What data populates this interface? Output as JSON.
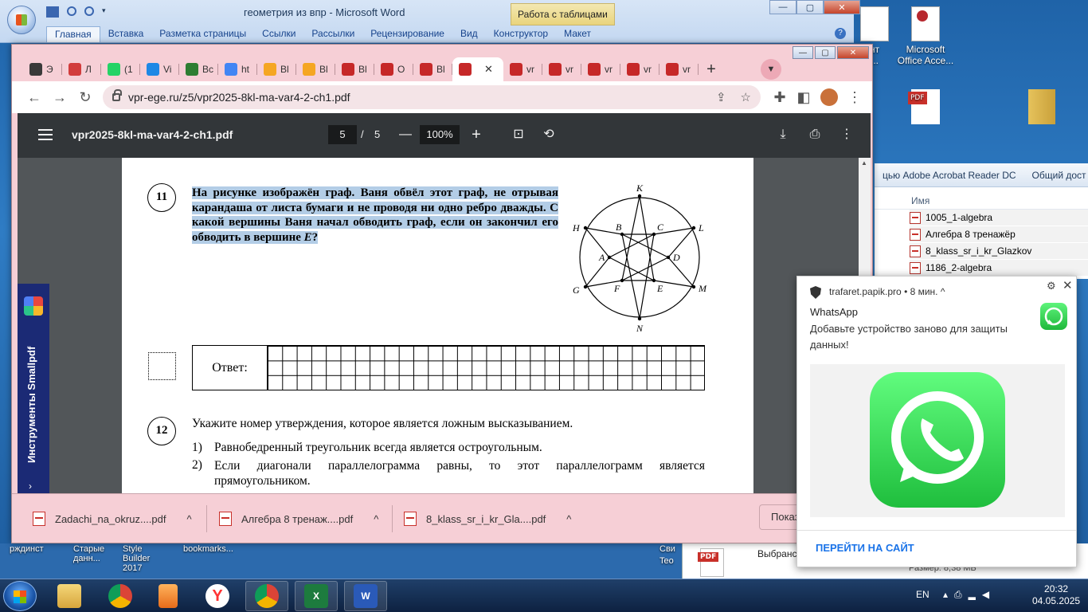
{
  "word": {
    "title": "геометрия из впр - Microsoft Word",
    "context_tab": "Работа с таблицами",
    "ribbon_tabs": [
      "Главная",
      "Вставка",
      "Разметка страницы",
      "Ссылки",
      "Рассылки",
      "Рецензирование",
      "Вид",
      "Конструктор",
      "Макет"
    ]
  },
  "desktop": {
    "icons": [
      {
        "label": "Microsoft Office Acce..."
      }
    ],
    "partial_labels": [
      "нт",
      "..."
    ],
    "bottom_labels": [
      "рждинст",
      "Старые данн...",
      "Style Builder 2017",
      "bookmarks...",
      "Сви",
      "Teo"
    ]
  },
  "explorer": {
    "toolbar": [
      "цью Adobe Acrobat Reader DC",
      "Общий дост"
    ],
    "column": "Имя",
    "files": [
      "1005_1-algebra",
      "Алгебра 8 тренажёр",
      "8_klass_sr_i_kr_Glazkov",
      "1186_2-algebra"
    ],
    "lower_file": "Выбранс",
    "lower_size": "Размер: 8,38 МБ"
  },
  "chrome": {
    "tabs": [
      {
        "text": "Э",
        "icon": "paw-icon",
        "color": "#3a3a3a"
      },
      {
        "text": "Л",
        "icon": "gift-icon",
        "color": "#d23c3c"
      },
      {
        "text": "(1",
        "icon": "whatsapp-icon",
        "color": "#25d366"
      },
      {
        "text": "Vi",
        "icon": "shield-icon",
        "color": "#1e88e5"
      },
      {
        "text": "Bc",
        "icon": "squares-icon",
        "color": "#2e7d32"
      },
      {
        "text": "ht",
        "icon": "google-icon",
        "color": "#4285f4"
      },
      {
        "text": "Bl",
        "icon": "sun-icon",
        "color": "#f5a623"
      },
      {
        "text": "Bl",
        "icon": "sun-icon",
        "color": "#f5a623"
      },
      {
        "text": "Bl",
        "icon": "chart-icon",
        "color": "#c62828"
      },
      {
        "text": "O",
        "icon": "chart-icon",
        "color": "#c62828"
      },
      {
        "text": "Bl",
        "icon": "chart-icon",
        "color": "#c62828"
      },
      {
        "text": "",
        "icon": "chart-icon",
        "color": "#c62828",
        "active": true
      },
      {
        "text": "vr",
        "icon": "chart-icon",
        "color": "#c62828"
      },
      {
        "text": "vr",
        "icon": "chart-icon",
        "color": "#c62828"
      },
      {
        "text": "vr",
        "icon": "chart-icon",
        "color": "#c62828"
      },
      {
        "text": "vr",
        "icon": "chart-icon",
        "color": "#c62828"
      },
      {
        "text": "vr",
        "icon": "chart-icon",
        "color": "#c62828"
      }
    ],
    "new_tab": "+",
    "url": "vpr-ege.ru/z5/vpr2025-8kl-ma-var4-2-ch1.pdf"
  },
  "pdf": {
    "filename": "vpr2025-8kl-ma-var4-2-ch1.pdf",
    "page": "5",
    "separator": "/",
    "total": "5",
    "zoom": "100%"
  },
  "document": {
    "q11_number": "11",
    "q11_text": "На рисунке изображён граф. Ваня обвёл этот граф, не отрывая карандаша от листа бумаги и не проводя ни одно ребро дважды. С какой вершины Ваня начал обводить граф, если он закончил его обводить в вершине ",
    "q11_vertex": "E",
    "q11_end": "?",
    "graph_vertices": [
      "K",
      "H",
      "B",
      "C",
      "L",
      "A",
      "D",
      "G",
      "F",
      "E",
      "M",
      "N"
    ],
    "answer_label": "Ответ:",
    "q12_number": "12",
    "q12_text": "Укажите номер утверждения, которое является ложным высказыванием.",
    "q12_options": [
      {
        "n": "1)",
        "text": "Равнобедренный треугольник всегда является остроугольным."
      },
      {
        "n": "2)",
        "text": "Если диагонали параллелограмма равны, то этот параллелограмм является прямоугольником."
      }
    ]
  },
  "smallpdf": {
    "label": "Инструменты Smallpdf"
  },
  "downloads": {
    "items": [
      "Zadachi_na_okruz....pdf",
      "Алгебра 8 тренаж....pdf",
      "8_klass_sr_i_kr_Gla....pdf"
    ],
    "show_all": "Показ"
  },
  "notification": {
    "source": "trafaret.papik.pro",
    "time": "• 8 мин. ^",
    "title": "WhatsApp",
    "body": "Добавьте устройство заново для защиты данных!",
    "action": "ПЕРЕЙТИ НА САЙТ"
  },
  "taskbar": {
    "lang": "EN",
    "time": "20:32",
    "date": "04.05.2025"
  }
}
